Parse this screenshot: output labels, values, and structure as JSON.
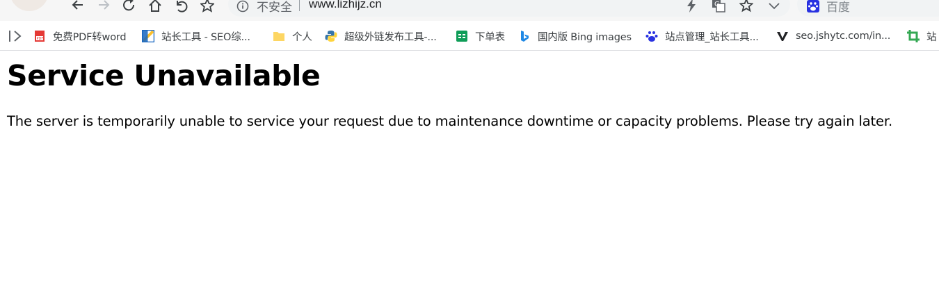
{
  "browser": {
    "omnibox": {
      "security_label": "不安全",
      "url": "www.lizhijz.cn"
    },
    "search_box": {
      "placeholder": "百度"
    },
    "bookmarks": [
      {
        "label": "免费PDF转word",
        "icon": "pdf-icon"
      },
      {
        "label": "站长工具 - SEO综...",
        "icon": "chinaz-icon"
      },
      {
        "label": "个人",
        "icon": "folder-icon"
      },
      {
        "label": "超级外链发布工具-...",
        "icon": "python-icon"
      },
      {
        "label": "下单表",
        "icon": "sheets-icon"
      },
      {
        "label": "国内版 Bing images",
        "icon": "bing-icon"
      },
      {
        "label": "站点管理_站长工具...",
        "icon": "baidu-paw-icon"
      },
      {
        "label": "seo.jshytc.com/in...",
        "icon": "v-logo-icon"
      },
      {
        "label": "站",
        "icon": "crop-icon"
      }
    ]
  },
  "page": {
    "title": "Service Unavailable",
    "message": "The server is temporarily unable to service your request due to maintenance downtime or capacity problems. Please try again later."
  },
  "colors": {
    "toolbar_bg": "#f6f6f6",
    "omnibox_bg": "#f1f3f4",
    "text": "#000000"
  }
}
